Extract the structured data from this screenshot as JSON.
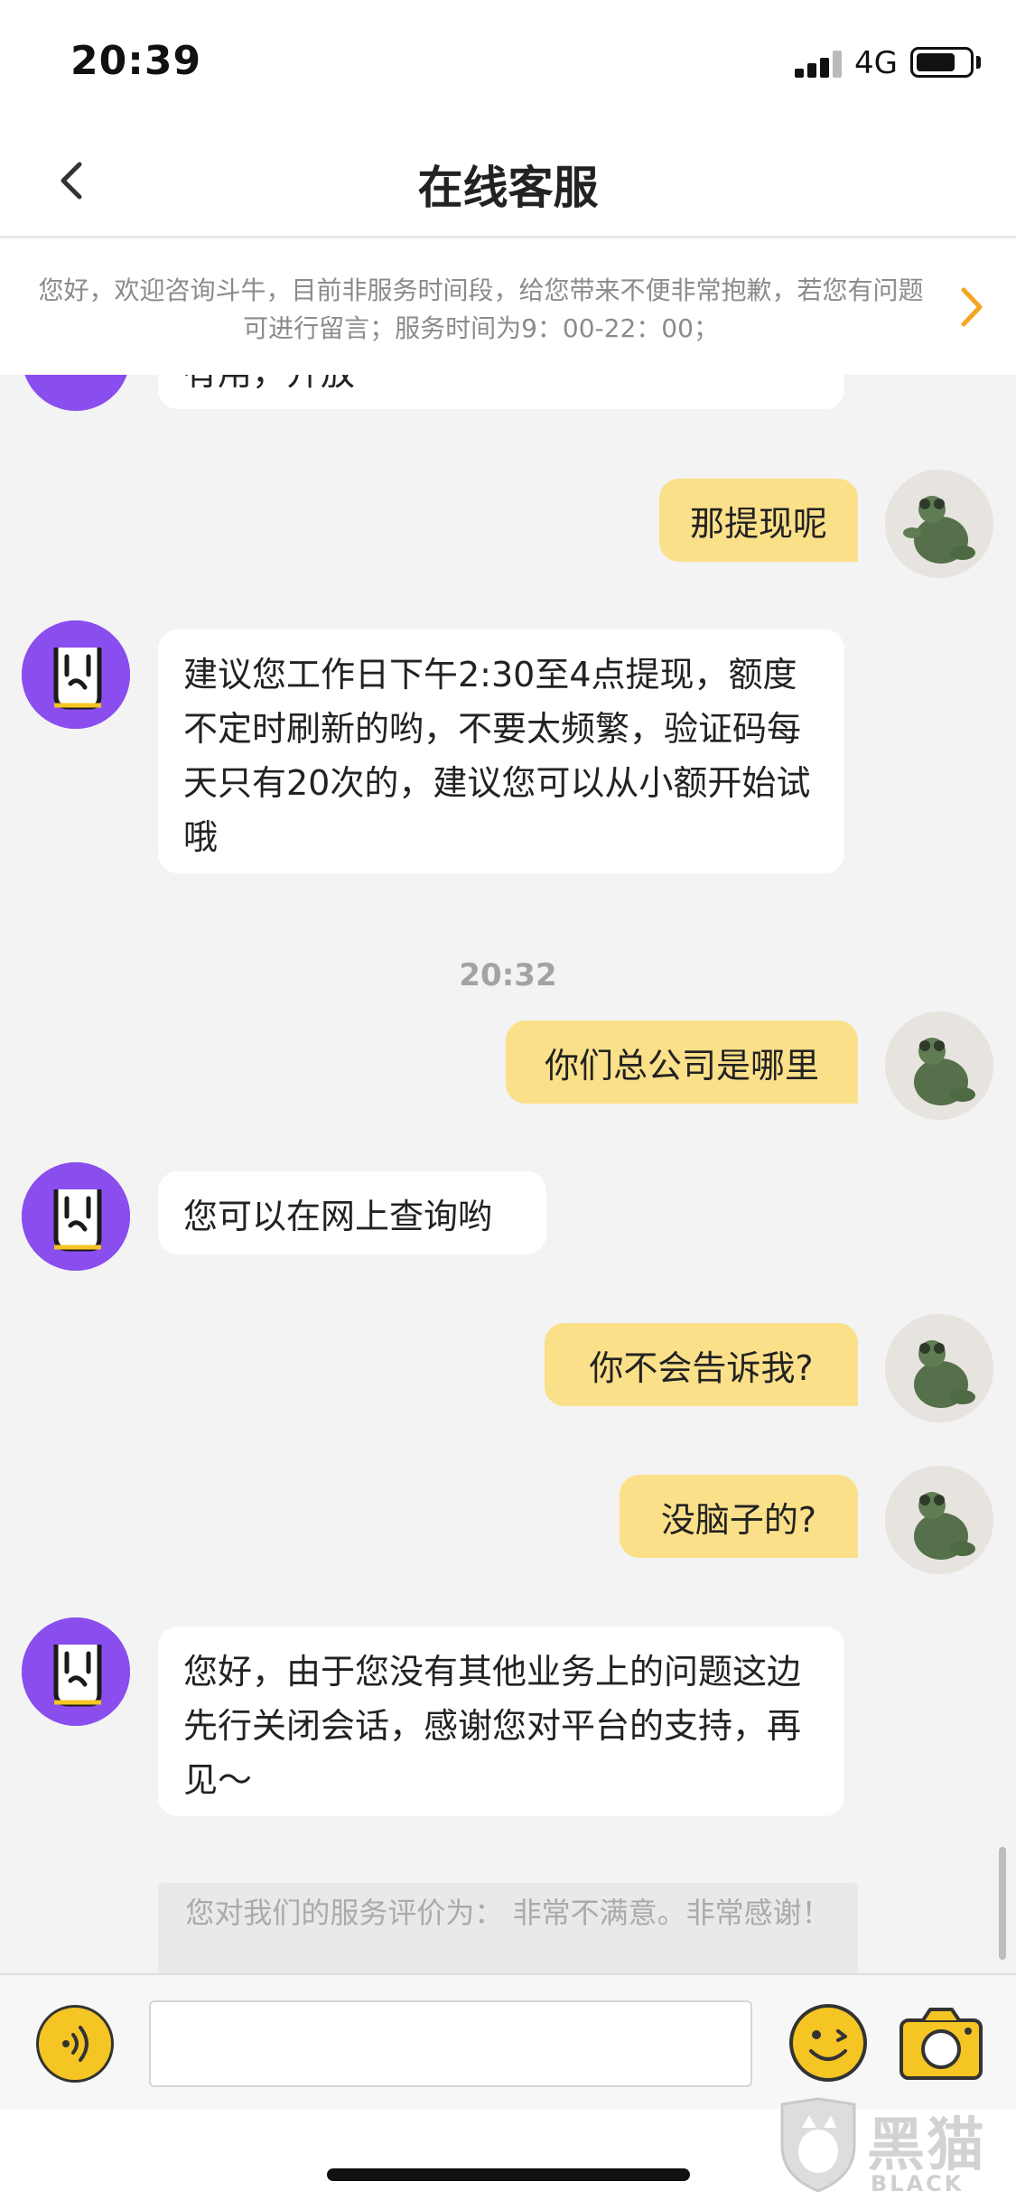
{
  "status_bar": {
    "time": "20:39",
    "network": "4G"
  },
  "nav": {
    "title": "在线客服"
  },
  "notice": {
    "text": "您好，欢迎咨询斗牛，目前非服务时间段，给您带来不便非常抱歉，若您有问题可进行留言；服务时间为9：00-22：00；"
  },
  "messages": [
    {
      "from": "bot",
      "text": "有用，开放"
    },
    {
      "from": "user",
      "text": "那提现呢"
    },
    {
      "from": "bot",
      "text": "建议您工作日下午2:30至4点提现，额度不定时刷新的哟，不要太频繁，验证码每天只有20次的，建议您可以从小额开始试哦"
    },
    {
      "from": "user",
      "text": "你们总公司是哪里"
    },
    {
      "from": "bot",
      "text": "您可以在网上查询哟"
    },
    {
      "from": "user",
      "text": "你不会告诉我?"
    },
    {
      "from": "user",
      "text": "没脑子的?"
    },
    {
      "from": "bot",
      "text": "您好，由于您没有其他业务上的问题这边先行关闭会话，感谢您对平台的支持，再见～"
    }
  ],
  "timestamp": "20:32",
  "rating": {
    "text": "您对我们的服务评价为： 非常不满意。非常感谢！"
  },
  "input": {
    "placeholder": ""
  },
  "watermark": {
    "cn": "黑猫",
    "en": "BLACK CAT"
  },
  "colors": {
    "accent": "#f5a623",
    "user_bubble": "#fbe08a",
    "bot_avatar": "#8a4dee"
  },
  "icons": [
    "back-arrow-icon",
    "chevron-right-icon",
    "voice-icon",
    "emoji-icon",
    "camera-icon",
    "rock-hand-icon"
  ]
}
